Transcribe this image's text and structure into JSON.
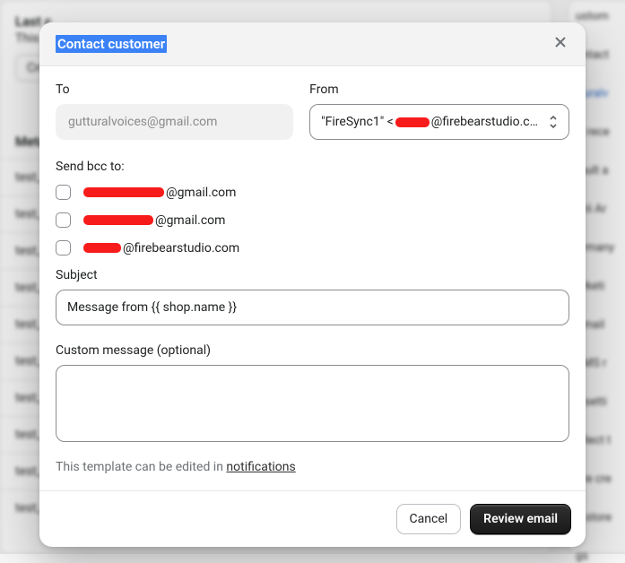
{
  "background": {
    "left": {
      "heading": "Last c",
      "subtext": "This c",
      "button": "Crea",
      "section": "Meta",
      "rows": [
        "test_v",
        "test_c",
        "test_p",
        "test_j",
        "test_r",
        "test_u",
        "test_r",
        "test_c",
        "test_b",
        "test_w"
      ]
    },
    "right": {
      "items": [
        "ustom",
        "ontact",
        "tturalv",
        "ill rece",
        "fault a",
        "drii Ar",
        "ermany",
        "arketi",
        "Email",
        "SMS r",
        "x setti",
        "ollect t",
        "ore cre",
        "o store",
        "gs"
      ]
    }
  },
  "modal": {
    "title": "Contact customer",
    "to": {
      "label": "To",
      "value": "gutturalvoices@gmail.com"
    },
    "from": {
      "label": "From",
      "prefix": "\"FireSync1\" <",
      "suffix": "@firebearstudio.c…"
    },
    "bcc": {
      "label": "Send bcc to:",
      "items": [
        {
          "suffix": "@gmail.com",
          "redactW": 90
        },
        {
          "suffix": "@gmail.com",
          "redactW": 78
        },
        {
          "suffix": "@firebearstudio.com",
          "redactW": 42
        }
      ]
    },
    "subject": {
      "label": "Subject",
      "value": "Message from {{ shop.name }}"
    },
    "message": {
      "label": "Custom message (optional)",
      "value": ""
    },
    "hint": {
      "text": "This template can be edited in ",
      "link": "notifications"
    },
    "footer": {
      "cancel": "Cancel",
      "review": "Review email"
    }
  }
}
